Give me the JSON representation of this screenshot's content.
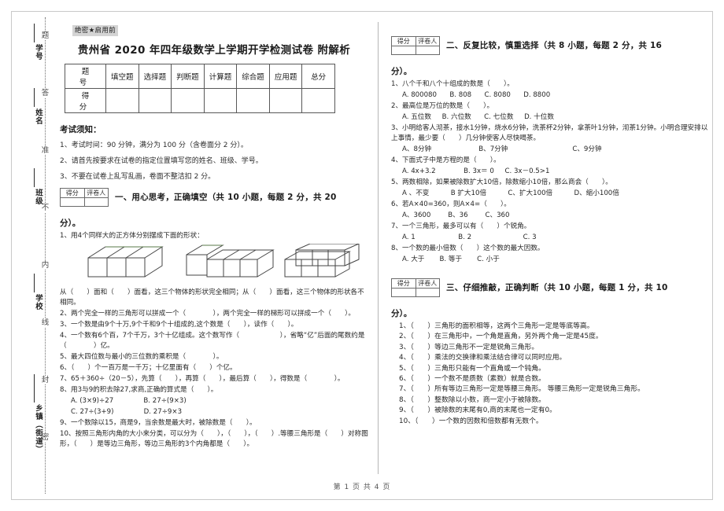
{
  "seal": {
    "dotted_chars": [
      "题",
      "答",
      "准",
      "不",
      "内",
      "线",
      "封",
      "密"
    ],
    "fields": [
      "学号",
      "姓名",
      "班级",
      "学校",
      "乡镇（街道）"
    ]
  },
  "header": {
    "secret_tag": "绝密★启用前",
    "title": "贵州省 2020 年四年级数学上学期开学检测试卷 附解析"
  },
  "score_table": {
    "row1_lead": "题　号",
    "row2_lead": "得　分",
    "columns": [
      "填空题",
      "选择题",
      "判断题",
      "计算题",
      "综合题",
      "应用题",
      "总分"
    ]
  },
  "notice": {
    "heading": "考试须知：",
    "items": [
      "1、考试时间：90 分钟，满分为 100 分（含卷面分 2 分）。",
      "2、请首先按要求在试卷的指定位置填写您的姓名、班级、学号。",
      "3、不要在试卷上乱写乱画，卷面不整洁扣 2 分。"
    ]
  },
  "grader_box": {
    "score_label": "得分",
    "marker_label": "评卷人"
  },
  "section1": {
    "title": "一、用心思考，正确填空（共 10 小题，每题 2 分，共 20",
    "title_cont": "分）。",
    "questions": [
      "1、用4个同样大的正方体分别摆成下面的形状：",
      "从（　　）面和（　　）面看，这三个物体的形状完全相同；从（　　）面看，这三个物体的形状各不相同。",
      "2、两个完全一样的三角形可以拼成一个（　　　　），两个完全一样的梯形可以拼成一个（　　）。",
      "3、一个数是由9个十万,9个千和9个十组成的,这个数是（　　），读作（　　）。",
      "4、一个数有6个百，7个千万，3个十亿组成。这个数写作（　　　　　　），省略“亿”后面的尾数约是（　　　　）亿。",
      "5、最大四位数与最小的三位数的乘积是（　　　　）。",
      "6、（　　）个一百万是一千万；十亿里面有（　　）个亿。",
      "7、65＋360÷（20－5），先算（　　），再算（　　），最后算（　　），得数是（　　　　）。",
      "8、用3与9的积去除27,求商,正确的算式是（　　）。",
      "9、一个数除以15，商是9，当余数是最大时，被除数是（　　）。",
      "10、按照三角形内角的大小来分类，可以分为（　　），（　　），（　　）.等腰三角形是（　　）对称图形，（　　）是等边三角形，等边三角形的3个内角都是（　　）。"
    ],
    "q8_options_line1": "A. (3×9)÷27              B. 27÷(9×3)",
    "q8_options_line2": "C. 27÷(3+9)              D. 27÷9×3"
  },
  "section2": {
    "title": "二、反复比较，慎重选择（共 8 小题，每题 2 分，共 16",
    "title_cont": "分）。",
    "questions": [
      {
        "stem": "1、八个千和八个十组成的数是（　　）。",
        "options": [
          "A. 800080      B. 808      C. 8080      D. 8800"
        ]
      },
      {
        "stem": "2、最高位是万位的数是（　　）。",
        "options": [
          "A. 五位数     B. 六位数      C. 七位数     D. 十位数"
        ]
      },
      {
        "stem": "3、小明给客人沏茶，接水1分钟，烧水6分钟，洗茶杯2分钟，拿茶叶1分钟，沏茶1分钟。小明合理安排以上事情，最少要（　　）几分钟使客人尽快喝茶。",
        "options": [
          "A、8分钟                      B、7分钟                              C、9分钟"
        ]
      },
      {
        "stem": "4、下面式子中是方程的是（　　）。",
        "options": [
          "A. 4x+3.2             B. 3x＝ 0     C. 3x－0.5>1"
        ]
      },
      {
        "stem": "5、两数相除，如果被除数扩大10倍，除数缩小10倍，那么商会（　　）。",
        "options": [
          "A 、不变          B 扩大10倍          C、扩大100倍          D、缩小100倍"
        ]
      },
      {
        "stem": "6、若A×40=360，则A×4=（　　）。",
        "options": [
          "A、3600        B、36        C、360"
        ]
      },
      {
        "stem": "7、一个三角形，最多可以有（　　）个锐角。",
        "options": [
          "A. 1                    B. 2                        C. 3"
        ]
      },
      {
        "stem": "8、一个数的最小倍数（　　）这个数的最大因数。",
        "options": [
          "A. 大于       B. 等于       C. 小于"
        ]
      }
    ]
  },
  "section3": {
    "title": "三、仔细推敲，正确判断（共 10 小题，每题 1 分，共 10",
    "title_cont": "分）。",
    "questions": [
      "1、（　　）三角形的面积相等，这两个三角形一定是等底等高。",
      "2、（　　）在三角形中，一个角是直角，另外两个角一定是45度。",
      "3、（　　）等边三角形不一定是锐角三角形。",
      "4、（　　）乘法的交换律和乘法结合律可以同时应用。",
      "5、（　　）三角形只能有一个直角或一个钝角。",
      "6、（　　）一个数不是质数（素数）就是合数。",
      "7、（　　）所有等边三角形一定是等腰三角形。 等腰三角形一定是锐角三角形。",
      "8、（　　）整数除以小数，商一定小于被除数。",
      "9、（　　）被除数的末尾有0,商的末尾也一定有0。",
      "10、（　　）一个数的因数和倍数都有无数个。"
    ]
  },
  "footer": {
    "text": "第 1 页  共 4 页"
  }
}
